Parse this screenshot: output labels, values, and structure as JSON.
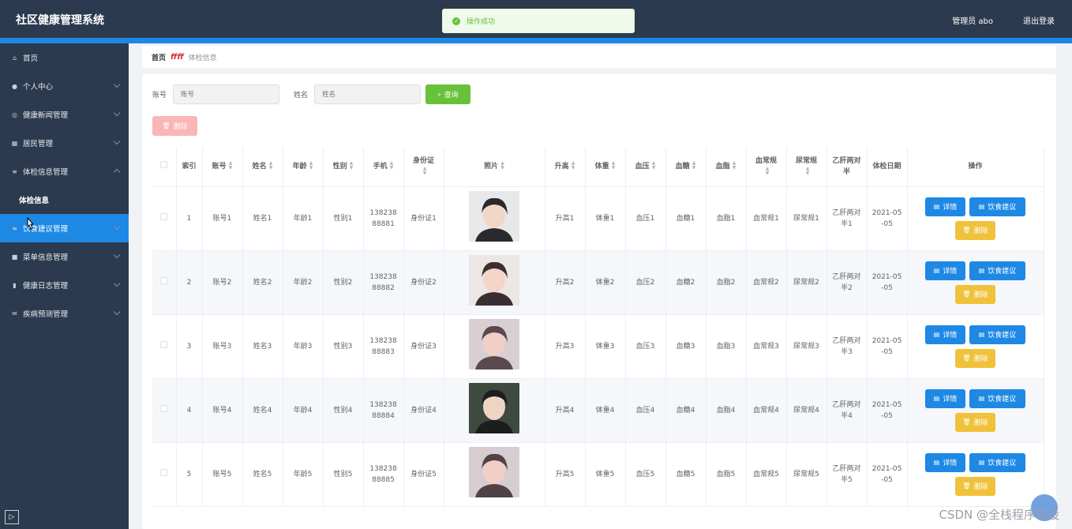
{
  "header": {
    "title": "社区健康管理系统",
    "user": "管理员 abo",
    "logout": "退出登录"
  },
  "toast": {
    "text": "操作成功"
  },
  "sidebar": {
    "items": [
      {
        "label": "首页",
        "icon": "home-icon"
      },
      {
        "label": "个人中心",
        "icon": "user-icon"
      },
      {
        "label": "健康新闻管理",
        "icon": "globe-icon"
      },
      {
        "label": "居民管理",
        "icon": "grid-icon"
      },
      {
        "label": "体检信息管理",
        "icon": "menu-icon"
      },
      {
        "label": "体检信息",
        "icon": ""
      },
      {
        "label": "饮食建议管理",
        "icon": "menu-icon"
      },
      {
        "label": "菜单信息管理",
        "icon": "book-icon"
      },
      {
        "label": "健康日志管理",
        "icon": "chart-icon"
      },
      {
        "label": "疾病预测管理",
        "icon": "mail-icon"
      }
    ],
    "collapse": "▷"
  },
  "breadcrumb": {
    "home": "首页",
    "sep": "ffff",
    "current": "体检信息"
  },
  "search": {
    "account_label": "账号",
    "account_placeholder": "账号",
    "name_label": "姓名",
    "name_placeholder": "姓名",
    "query": "查询"
  },
  "toolbar": {
    "delete": "删除"
  },
  "table": {
    "headers": [
      "索引",
      "账号",
      "姓名",
      "年龄",
      "性别",
      "手机",
      "身份证",
      "照片",
      "升高",
      "体重",
      "血压",
      "血糖",
      "血脂",
      "血常规",
      "尿常规",
      "乙肝两对半",
      "体检日期",
      "操作"
    ],
    "rows": [
      {
        "idx": "1",
        "acct": "账号1",
        "name": "姓名1",
        "age": "年龄1",
        "sex": "性别1",
        "phone": "13823888881",
        "id": "身份证1",
        "h": "升高1",
        "w": "体重1",
        "bp": "血压1",
        "bs": "血糖1",
        "bl": "血脂1",
        "rt": "血常规1",
        "ut": "尿常规1",
        "hb": "乙肝两对半1",
        "date": "2021-05-05"
      },
      {
        "idx": "2",
        "acct": "账号2",
        "name": "姓名2",
        "age": "年龄2",
        "sex": "性别2",
        "phone": "13823888882",
        "id": "身份证2",
        "h": "升高2",
        "w": "体重2",
        "bp": "血压2",
        "bs": "血糖2",
        "bl": "血脂2",
        "rt": "血常规2",
        "ut": "尿常规2",
        "hb": "乙肝两对半2",
        "date": "2021-05-05"
      },
      {
        "idx": "3",
        "acct": "账号3",
        "name": "姓名3",
        "age": "年龄3",
        "sex": "性别3",
        "phone": "13823888883",
        "id": "身份证3",
        "h": "升高3",
        "w": "体重3",
        "bp": "血压3",
        "bs": "血糖3",
        "bl": "血脂3",
        "rt": "血常规3",
        "ut": "尿常规3",
        "hb": "乙肝两对半3",
        "date": "2021-05-05"
      },
      {
        "idx": "4",
        "acct": "账号4",
        "name": "姓名4",
        "age": "年龄4",
        "sex": "性别4",
        "phone": "13823888884",
        "id": "身份证4",
        "h": "升高4",
        "w": "体重4",
        "bp": "血压4",
        "bs": "血糖4",
        "bl": "血脂4",
        "rt": "血常规4",
        "ut": "尿常规4",
        "hb": "乙肝两对半4",
        "date": "2021-05-05"
      },
      {
        "idx": "5",
        "acct": "账号5",
        "name": "姓名5",
        "age": "年龄5",
        "sex": "性别5",
        "phone": "13823888885",
        "id": "身份证5",
        "h": "升高5",
        "w": "体重5",
        "bp": "血压5",
        "bs": "血糖5",
        "bl": "血脂5",
        "rt": "血常规5",
        "ut": "尿常规5",
        "hb": "乙肝两对半5",
        "date": "2021-05-05"
      }
    ],
    "actions": {
      "detail": "详情",
      "diet": "饮食建议",
      "delete": "删除"
    }
  },
  "watermark": "CSDN @全栈程序毕设",
  "colors": {
    "header": "#2b3a4e",
    "accent": "#1e88e5",
    "success": "#67c23a",
    "warning": "#f0c23b"
  }
}
